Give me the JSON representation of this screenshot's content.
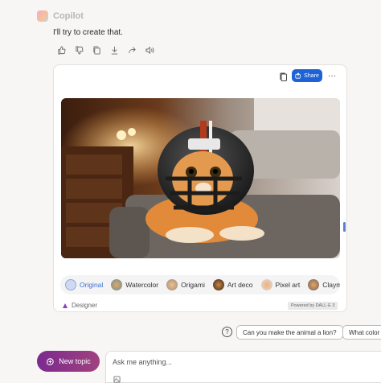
{
  "bot": {
    "name": "Copilot"
  },
  "message": {
    "text": "I'll try to create that."
  },
  "message_actions": [
    "thumbs-up-icon",
    "thumbs-down-icon",
    "copy-icon",
    "download-icon",
    "share-icon",
    "speaker-icon"
  ],
  "card": {
    "share_label": "Share",
    "more_label": "···",
    "styles": [
      {
        "label": "Original",
        "selected": true
      },
      {
        "label": "Watercolor",
        "selected": false
      },
      {
        "label": "Origami",
        "selected": false
      },
      {
        "label": "Art deco",
        "selected": false
      },
      {
        "label": "Pixel art",
        "selected": false
      },
      {
        "label": "Claymat",
        "selected": false
      }
    ],
    "designer_label": "Designer",
    "powered_label": "Powered by DALL·E 3"
  },
  "suggestions": [
    "Can you make the animal a lion?",
    "What color"
  ],
  "composer": {
    "new_topic_label": "New topic",
    "placeholder": "Ask me anything..."
  },
  "colors": {
    "accent": "#1e63d6",
    "new_topic": "#8a3389"
  }
}
